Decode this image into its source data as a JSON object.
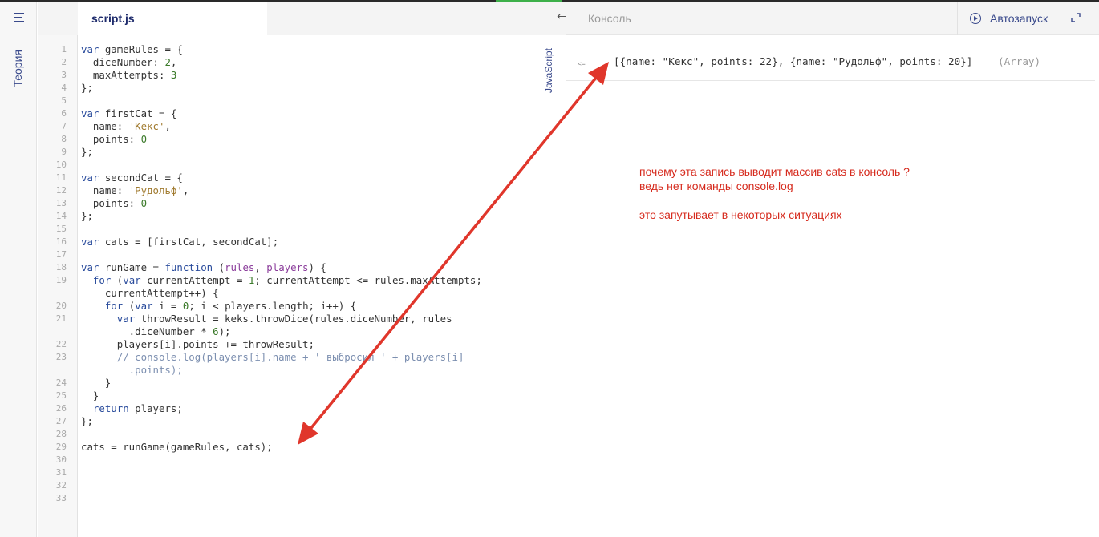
{
  "sidebar": {
    "tab_label": "Теория",
    "menu_icon": "hamburger-icon"
  },
  "editor": {
    "file_tab": "script.js",
    "language_label": "JavaScript",
    "line_numbers": [
      "1",
      "2",
      "3",
      "4",
      "5",
      "6",
      "7",
      "8",
      "9",
      "10",
      "11",
      "12",
      "13",
      "14",
      "15",
      "16",
      "17",
      "18",
      "19",
      "",
      "20",
      "21",
      "",
      "22",
      "23",
      "",
      "24",
      "25",
      "26",
      "27",
      "28",
      "29",
      "30",
      "31",
      "32",
      "33"
    ]
  },
  "console": {
    "title": "Консоль",
    "autorun_label": "Автозапуск",
    "output_marker": "<=",
    "output_value": "[{name: \"Кекс\", points: 22}, {name: \"Рудольф\", points: 20}]",
    "output_type": "(Array)"
  },
  "annotation": {
    "lines": [
      "почему эта запись выводит массив cats  в консоль ?",
      "ведь нет команды console.log",
      "это запутывает в некоторых ситуациях"
    ],
    "color": "#d62b1e"
  },
  "colors": {
    "accent": "#3a4a8c",
    "progress": "#3db04a",
    "annotation": "#d62b1e"
  }
}
